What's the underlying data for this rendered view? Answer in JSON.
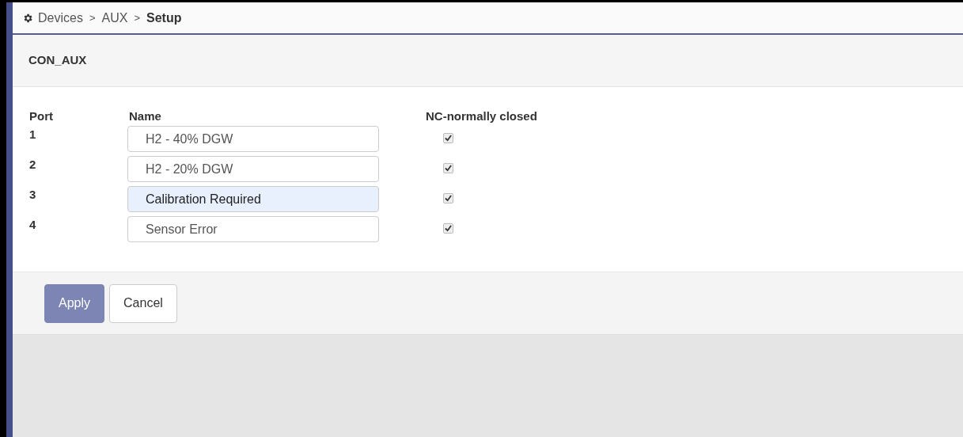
{
  "breadcrumb": {
    "items": [
      "Devices",
      "AUX"
    ],
    "separators": [
      ">",
      ">"
    ],
    "current": "Setup"
  },
  "panel": {
    "title": "CON_AUX",
    "columns": [
      "Port",
      "Name",
      "NC-normally closed"
    ],
    "rows": [
      {
        "port": "1",
        "name": "H2 - 40% DGW",
        "highlighted": false,
        "checked": true
      },
      {
        "port": "2",
        "name": "H2 - 20% DGW",
        "highlighted": false,
        "checked": true
      },
      {
        "port": "3",
        "name": "Calibration Required",
        "highlighted": true,
        "checked": true
      },
      {
        "port": "4",
        "name": "Sensor Error",
        "highlighted": false,
        "checked": true
      }
    ]
  },
  "buttons": [
    {
      "label": "Apply",
      "kind": "primary",
      "disabled": true
    },
    {
      "label": "Cancel",
      "kind": "default",
      "disabled": false
    }
  ]
}
